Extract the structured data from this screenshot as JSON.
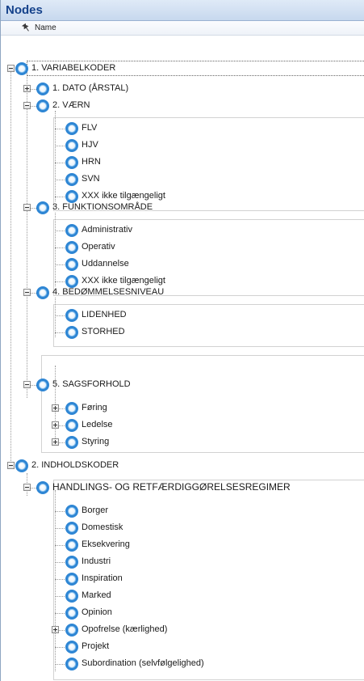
{
  "panel": {
    "title": "Nodes",
    "column_header": "Name",
    "pin_icon": "pin-icon",
    "node_icon": "node-circle-icon"
  },
  "tree": {
    "variabel": {
      "label": "1. VARIABELKODER",
      "dato": {
        "label": "1. DATO (ÅRSTAL)"
      },
      "vaern": {
        "label": "2. VÆRN",
        "items": [
          "FLV",
          "HJV",
          "HRN",
          "SVN",
          "XXX ikke tilgængeligt"
        ]
      },
      "funktion": {
        "label": "3. FUNKTIONSOMRÅDE",
        "items": [
          "Administrativ",
          "Operativ",
          "Uddannelse",
          "XXX  ikke tilgængeligt"
        ]
      },
      "bedommelse": {
        "label": "4. BEDØMMELSESNIVEAU",
        "items": [
          "LIDENHED",
          "STORHED"
        ]
      },
      "sagsforhold": {
        "label": "5. SAGSFORHOLD",
        "items": [
          "Føring",
          "Ledelse",
          "Styring"
        ]
      }
    },
    "indhold": {
      "label": "2. INDHOLDSKODER",
      "handlings": {
        "label": "HANDLINGS- OG RETFÆRDIGGØRELSESREGIMER",
        "items": [
          "Borger",
          "Domestisk",
          "Eksekvering",
          "Industri",
          "Inspiration",
          "Marked",
          "Opinion",
          "Opofrelse (kærlighed)",
          "Projekt",
          "Subordination (selvfølgelighed)"
        ]
      }
    }
  }
}
